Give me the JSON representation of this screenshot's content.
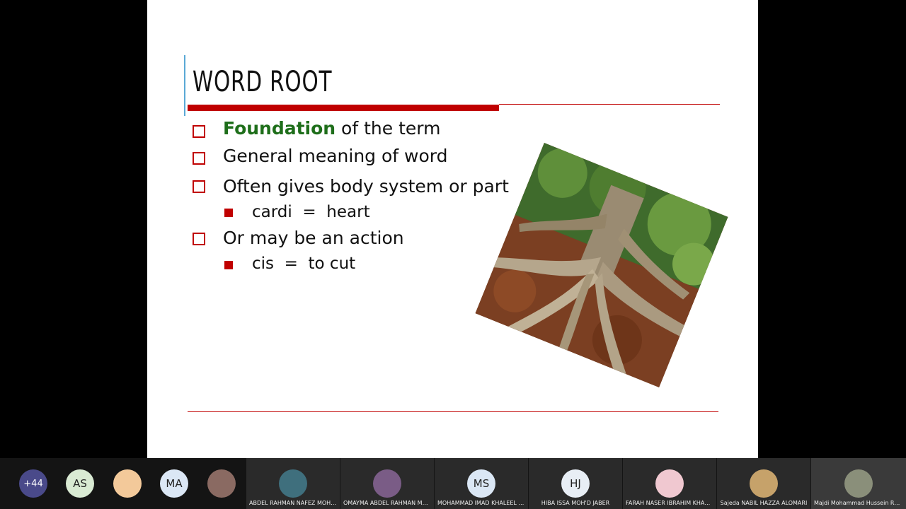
{
  "slide": {
    "title": "WORD ROOT",
    "bullets": [
      {
        "bold": "Foundation",
        "text": " of the term"
      },
      {
        "text": "General meaning of word"
      },
      {
        "text": "Often gives body system or part"
      },
      {
        "text": "Or may be an action"
      }
    ],
    "subbullets": [
      {
        "text": "cardi  =  heart"
      },
      {
        "text": "cis  =  to cut"
      }
    ]
  },
  "participants": {
    "more_count": "+44",
    "small": [
      {
        "initials": "AS",
        "color": "#d9ead3"
      },
      {
        "initials": "",
        "color": "#f3c99a"
      },
      {
        "initials": "MA",
        "color": "#dbe7f5"
      },
      {
        "initials": "",
        "color": "#8a6a62"
      }
    ],
    "tiles": [
      {
        "initials": "",
        "name": "ABDEL RAHMAN NAFEZ MOHAMM...",
        "color": "#3f6f7d"
      },
      {
        "initials": "",
        "name": "OMAYMA ABDEL RAHMAN MUSTA...",
        "color": "#7a5c86"
      },
      {
        "initials": "MS",
        "name": "MOHAMMAD IMAD KHALEEL SALEM",
        "color": "#dbe7f5"
      },
      {
        "initials": "HJ",
        "name": "HIBA ISSA MOH'D JABER",
        "color": "#e8eef5"
      },
      {
        "initials": "",
        "name": "FARAH NASER IBRAHIM KHASHAS...",
        "color": "#f0c8d0"
      },
      {
        "initials": "",
        "name": "Sajeda NABIL HAZZA ALOMARI",
        "color": "#c6a26a"
      },
      {
        "initials": "",
        "name": "Majdi Mohammad Hussein Rababa",
        "color": "#8a8f7a"
      }
    ]
  }
}
